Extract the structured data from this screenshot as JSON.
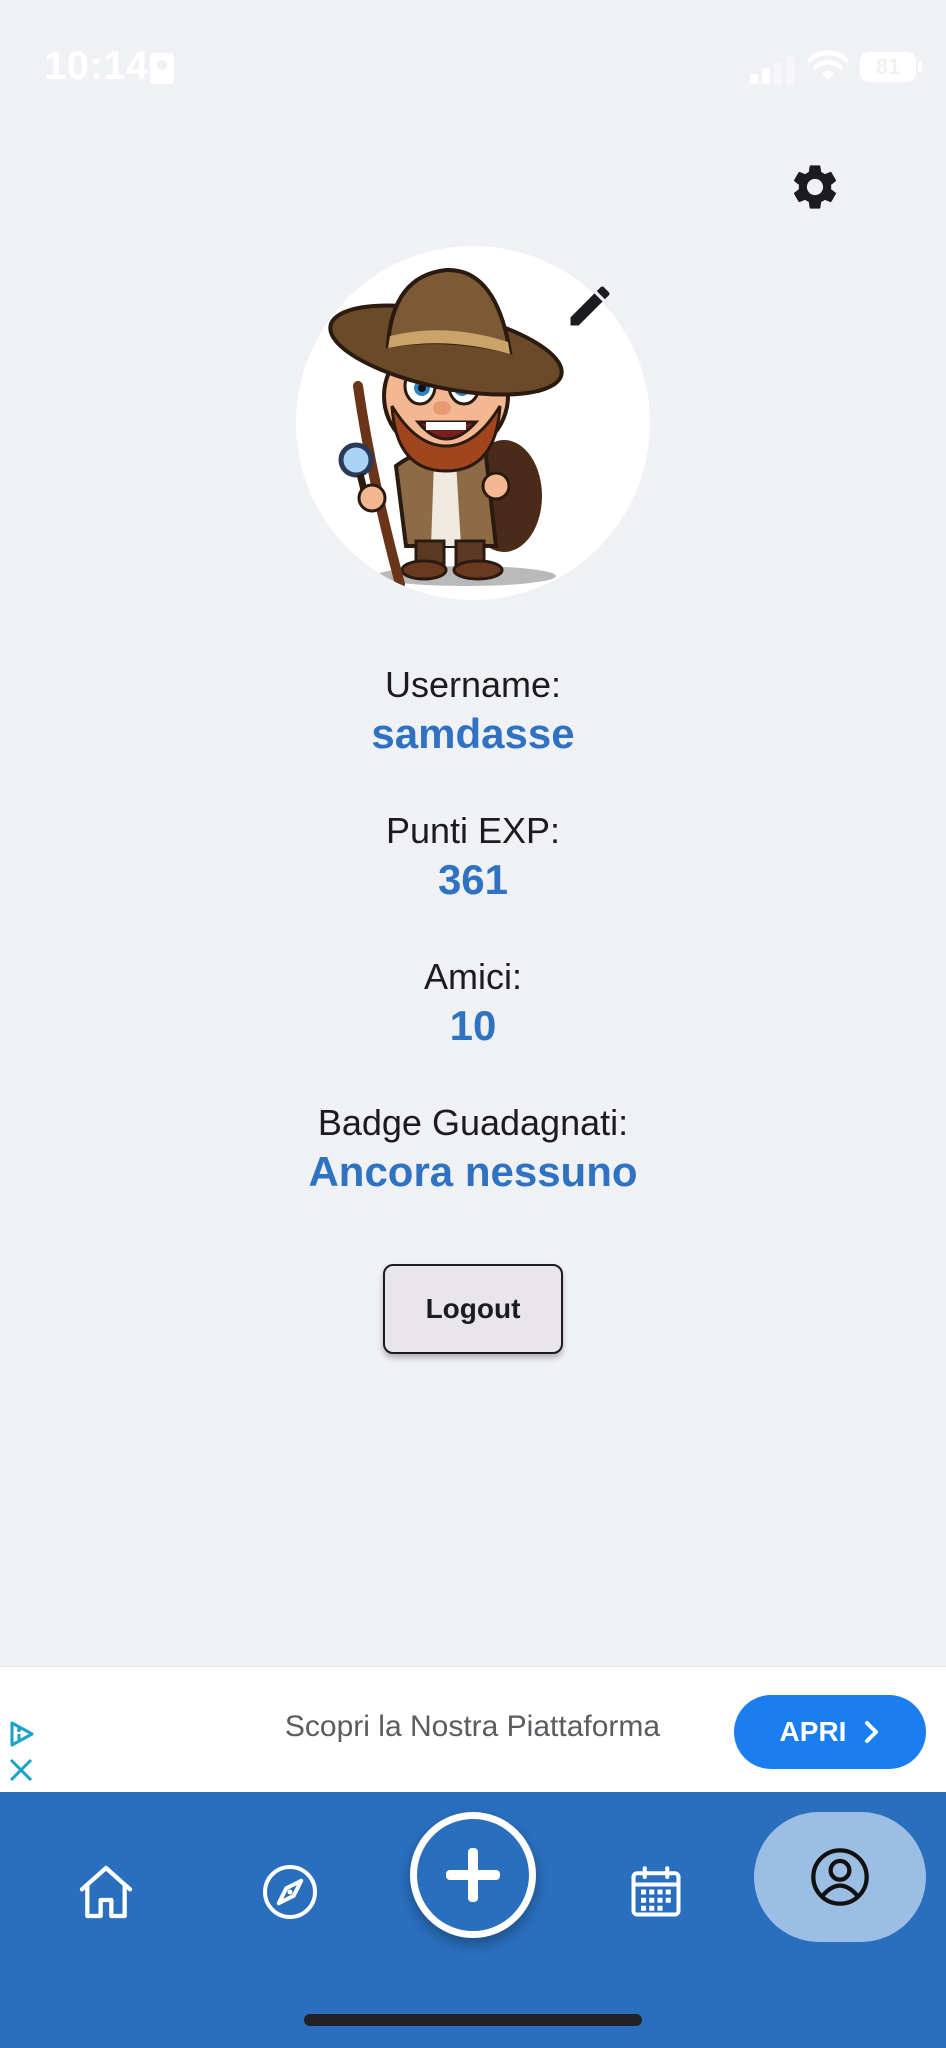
{
  "status_bar": {
    "time": "10:14",
    "battery": "81"
  },
  "profile": {
    "username_label": "Username:",
    "username_value": "samdasse",
    "exp_label": "Punti EXP:",
    "exp_value": "361",
    "friends_label": "Amici:",
    "friends_value": "10",
    "badges_label": "Badge Guadagnati:",
    "badges_value": "Ancora nessuno",
    "logout_label": "Logout"
  },
  "ad": {
    "text": "Scopri la Nostra Piattaforma",
    "button_label": "APRI"
  },
  "nav": {
    "items": [
      {
        "icon": "home-icon"
      },
      {
        "icon": "compass-icon"
      },
      {
        "icon": "plus-icon"
      },
      {
        "icon": "calendar-icon"
      },
      {
        "icon": "profile-icon",
        "active": true
      }
    ]
  },
  "colors": {
    "accent": "#2f72c1",
    "nav_bg": "#2a6fbe",
    "active_pill": "#9cbde4",
    "ad_button": "#1a7df0"
  }
}
